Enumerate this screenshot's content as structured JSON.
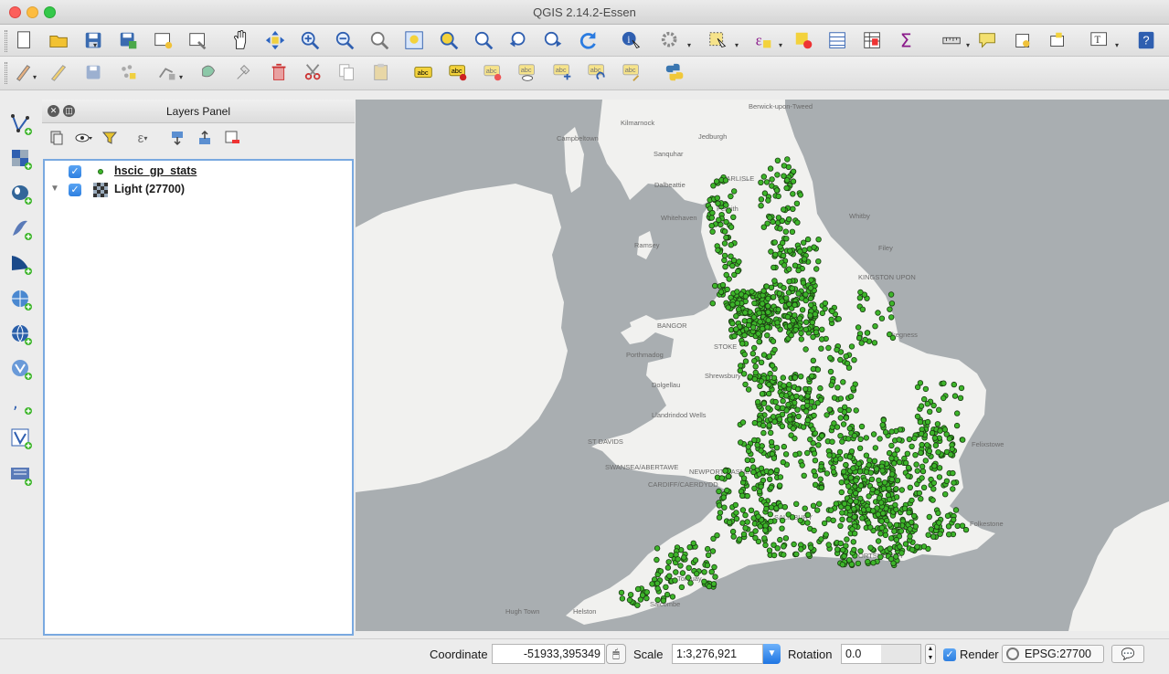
{
  "window": {
    "title": "QGIS 2.14.2-Essen"
  },
  "toolbar_primary": [
    {
      "name": "new-project-icon"
    },
    {
      "name": "open-project-icon"
    },
    {
      "name": "save-project-icon"
    },
    {
      "name": "save-as-icon"
    },
    {
      "name": "new-print-composer-icon"
    },
    {
      "name": "composer-manager-icon"
    },
    {
      "name": "pan-map-icon"
    },
    {
      "name": "pan-to-selection-icon"
    },
    {
      "name": "zoom-in-icon"
    },
    {
      "name": "zoom-out-icon"
    },
    {
      "name": "zoom-actual-size-icon"
    },
    {
      "name": "zoom-full-icon"
    },
    {
      "name": "zoom-to-selection-icon"
    },
    {
      "name": "zoom-to-layer-icon"
    },
    {
      "name": "zoom-last-icon"
    },
    {
      "name": "zoom-next-icon"
    },
    {
      "name": "refresh-icon"
    },
    {
      "name": "identify-features-icon"
    },
    {
      "name": "actions-icon"
    },
    {
      "name": "select-features-icon"
    },
    {
      "name": "select-by-expression-icon"
    },
    {
      "name": "deselect-all-icon"
    },
    {
      "name": "attribute-table-icon"
    },
    {
      "name": "field-calculator-icon"
    },
    {
      "name": "statistics-sum-icon"
    },
    {
      "name": "measure-line-icon"
    },
    {
      "name": "map-tips-icon"
    },
    {
      "name": "new-bookmark-icon"
    },
    {
      "name": "show-bookmarks-icon"
    },
    {
      "name": "text-annotation-icon"
    },
    {
      "name": "help-icon"
    }
  ],
  "toolbar_secondary": [
    {
      "name": "current-edits-icon"
    },
    {
      "name": "toggle-editing-icon"
    },
    {
      "name": "save-layer-edits-icon"
    },
    {
      "name": "add-feature-icon"
    },
    {
      "name": "node-tool-icon"
    },
    {
      "name": "move-feature-icon"
    },
    {
      "name": "node-edit-icon"
    },
    {
      "name": "delete-selected-icon"
    },
    {
      "name": "cut-features-icon"
    },
    {
      "name": "copy-features-icon"
    },
    {
      "name": "paste-features-icon"
    },
    {
      "name": "label-tool-icon"
    },
    {
      "name": "pin-labels-icon"
    },
    {
      "name": "highlight-pinned-labels-icon"
    },
    {
      "name": "show-hide-labels-icon"
    },
    {
      "name": "move-label-icon"
    },
    {
      "name": "rotate-label-icon"
    },
    {
      "name": "change-label-icon"
    },
    {
      "name": "python-console-icon"
    }
  ],
  "left_toolbar": [
    {
      "name": "add-vector-layer-icon"
    },
    {
      "name": "add-raster-layer-icon"
    },
    {
      "name": "add-postgis-layer-icon"
    },
    {
      "name": "add-spatialite-layer-icon"
    },
    {
      "name": "add-mssql-layer-icon"
    },
    {
      "name": "add-wms-layer-icon"
    },
    {
      "name": "add-wcs-layer-icon"
    },
    {
      "name": "add-wfs-layer-icon"
    },
    {
      "name": "add-delimited-text-icon"
    },
    {
      "name": "new-shapefile-icon"
    },
    {
      "name": "add-virtual-layer-icon"
    }
  ],
  "layers_panel": {
    "title": "Layers Panel",
    "layers": [
      {
        "name": "hscic_gp_stats",
        "checked": true,
        "type": "point"
      },
      {
        "name": "Light (27700)",
        "checked": true,
        "type": "raster"
      }
    ]
  },
  "map": {
    "point_color": "#3db52a",
    "sea_color": "#a9aeb1",
    "land_color": "#f1f1ef",
    "places": [
      {
        "label": "Berwick-upon-Tweed"
      },
      {
        "label": "Kilmarnock"
      },
      {
        "label": "Jedburgh"
      },
      {
        "label": "Campbeltown"
      },
      {
        "label": "Sanquhar"
      },
      {
        "label": "Dalbeattie"
      },
      {
        "label": "CARLISLE"
      },
      {
        "label": "Penrith"
      },
      {
        "label": "Whitehaven"
      },
      {
        "label": "Ramsey"
      },
      {
        "label": "Whitby"
      },
      {
        "label": "Filey"
      },
      {
        "label": "KINGSTON UPON"
      },
      {
        "label": "BANGOR"
      },
      {
        "label": "Skegness"
      },
      {
        "label": "Porthmadog"
      },
      {
        "label": "STOKE"
      },
      {
        "label": "Shrewsbury"
      },
      {
        "label": "Dolgellau"
      },
      {
        "label": "Llandrindod Wells"
      },
      {
        "label": "ST DAVIDS"
      },
      {
        "label": "Felixstowe"
      },
      {
        "label": "SWANSEA/ABERTAWE"
      },
      {
        "label": "NEWPORT/CASNEWYDD"
      },
      {
        "label": "CARDIFF/CAERDYDD"
      },
      {
        "label": "SALISBURY"
      },
      {
        "label": "Folkestone"
      },
      {
        "label": "Torquay"
      },
      {
        "label": "PORTSMOUTH"
      },
      {
        "label": "Salcombe"
      },
      {
        "label": "Helston"
      },
      {
        "label": "Hugh Town"
      }
    ]
  },
  "statusbar": {
    "coordinate_label": "Coordinate",
    "coordinate_value": "-51933,395349",
    "scale_label": "Scale",
    "scale_value": "1:3,276,921",
    "rotation_label": "Rotation",
    "rotation_value": "0.0",
    "render_label": "Render",
    "render_checked": true,
    "crs": "EPSG:27700"
  }
}
